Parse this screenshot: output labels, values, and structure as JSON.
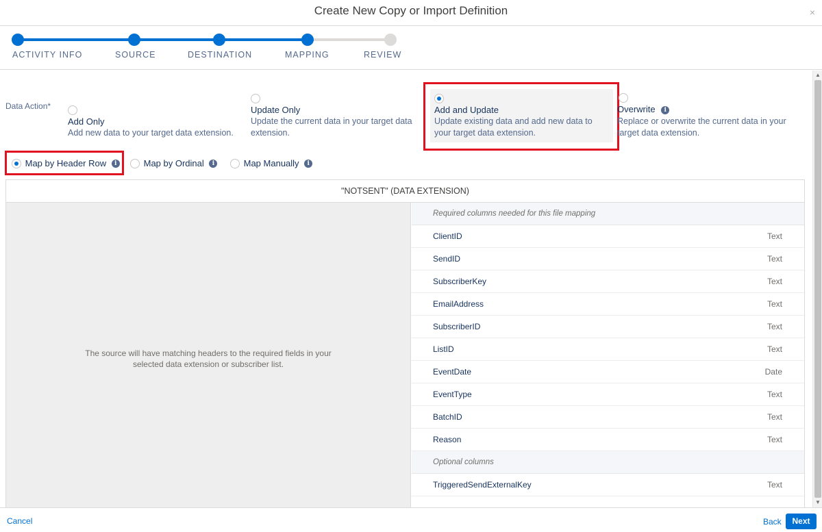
{
  "header": {
    "title": "Create New Copy or Import Definition",
    "close_symbol": "×"
  },
  "stepper": {
    "completed_color": "#0070d2",
    "pending_color": "#dddbda",
    "steps": [
      {
        "label": "ACTIVITY INFO",
        "state": "complete"
      },
      {
        "label": "SOURCE",
        "state": "complete"
      },
      {
        "label": "DESTINATION",
        "state": "complete"
      },
      {
        "label": "MAPPING",
        "state": "current"
      },
      {
        "label": "REVIEW",
        "state": "pending"
      }
    ]
  },
  "data_action": {
    "label": "Data Action*",
    "options": [
      {
        "title": "Add Only",
        "desc": "Add new data to your target data extension.",
        "selected": false
      },
      {
        "title": "Update Only",
        "desc": "Update the current data in your target data extension.",
        "selected": false
      },
      {
        "title": "Add and Update",
        "desc": "Update existing data and add new data to your target data extension.",
        "selected": true
      },
      {
        "title": "Overwrite",
        "desc": "Replace or overwrite the current data in your target data extension.",
        "selected": false
      }
    ]
  },
  "mapping_modes": [
    {
      "label": "Map by Header Row",
      "selected": true
    },
    {
      "label": "Map by Ordinal",
      "selected": false
    },
    {
      "label": "Map Manually",
      "selected": false
    }
  ],
  "table": {
    "title": "\"NOTSENT\" (DATA EXTENSION)",
    "left_message": "The source will have matching headers to the required fields in your selected data extension or subscriber list.",
    "required_header": "Required columns needed for this file mapping",
    "required_rows": [
      {
        "name": "ClientID",
        "type": "Text"
      },
      {
        "name": "SendID",
        "type": "Text"
      },
      {
        "name": "SubscriberKey",
        "type": "Text"
      },
      {
        "name": "EmailAddress",
        "type": "Text"
      },
      {
        "name": "SubscriberID",
        "type": "Text"
      },
      {
        "name": "ListID",
        "type": "Text"
      },
      {
        "name": "EventDate",
        "type": "Date"
      },
      {
        "name": "EventType",
        "type": "Text"
      },
      {
        "name": "BatchID",
        "type": "Text"
      },
      {
        "name": "Reason",
        "type": "Text"
      }
    ],
    "optional_header": "Optional columns",
    "optional_rows": [
      {
        "name": "TriggeredSendExternalKey",
        "type": "Text"
      }
    ]
  },
  "footer": {
    "cancel_label": "Cancel",
    "back_label": "Back",
    "next_label": "Next"
  },
  "colors": {
    "highlight": "#e0121f",
    "accent": "#0070d2"
  }
}
